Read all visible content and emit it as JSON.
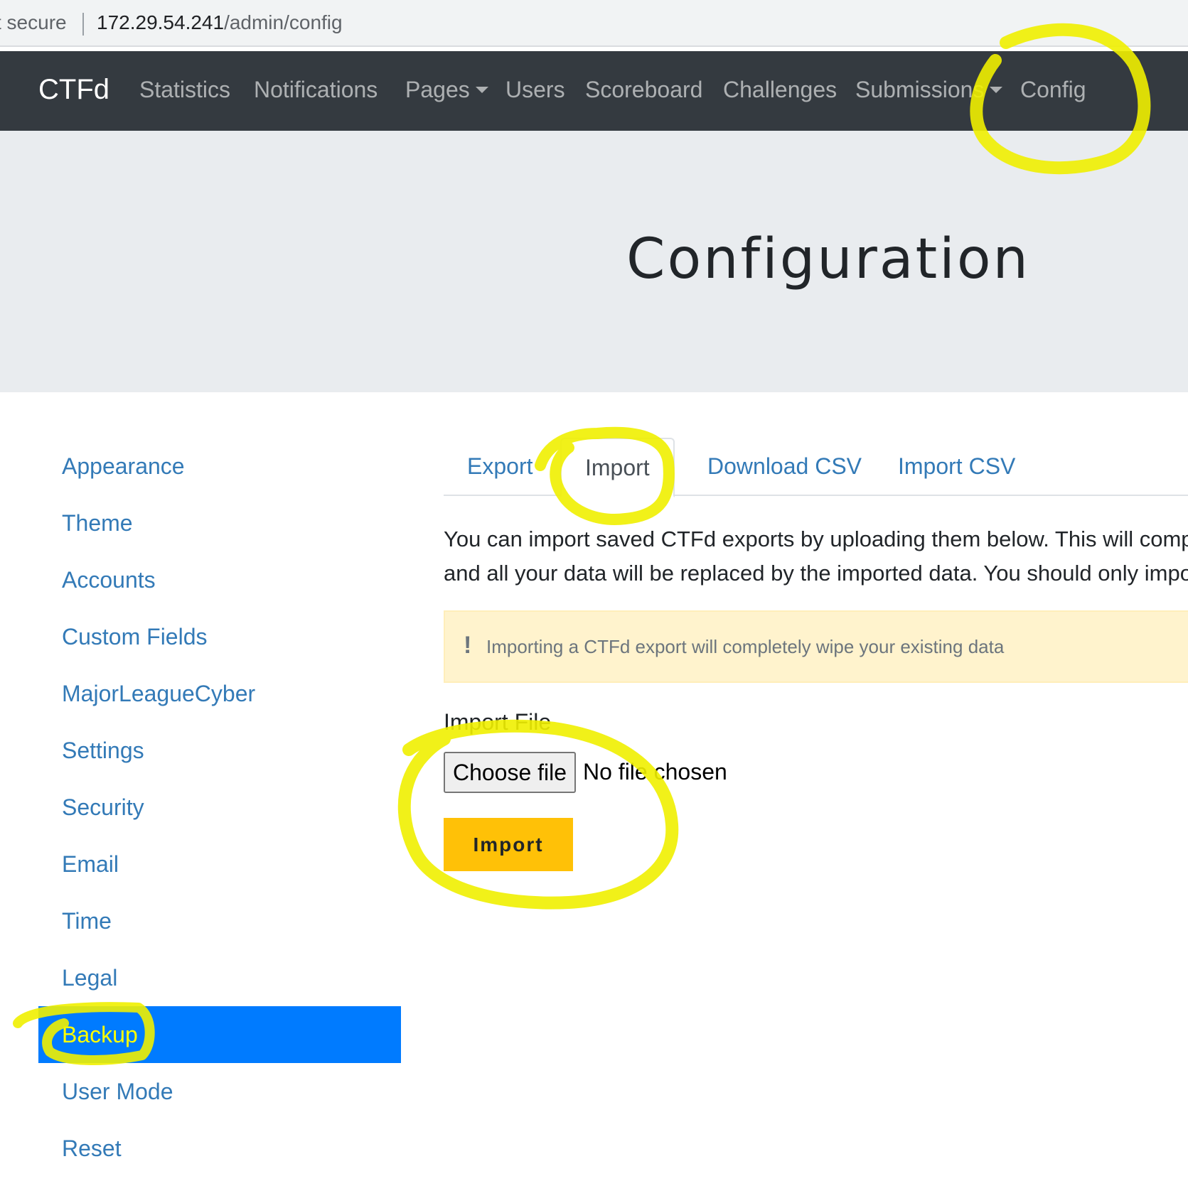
{
  "browser": {
    "security_text": "t secure",
    "url_host": "172.29.54.241",
    "url_path": "/admin/config"
  },
  "navbar": {
    "brand": "CTFd",
    "items": [
      {
        "label": "Statistics"
      },
      {
        "label": "Notifications"
      },
      {
        "label": "Pages",
        "dropdown": true
      },
      {
        "label": "Users"
      },
      {
        "label": "Scoreboard"
      },
      {
        "label": "Challenges"
      },
      {
        "label": "Submissions",
        "dropdown": true
      },
      {
        "label": "Config"
      }
    ]
  },
  "header": {
    "title": "Configuration"
  },
  "sidebar": {
    "items": [
      {
        "label": "Appearance"
      },
      {
        "label": "Theme"
      },
      {
        "label": "Accounts"
      },
      {
        "label": "Custom Fields"
      },
      {
        "label": "MajorLeagueCyber"
      },
      {
        "label": "Settings"
      },
      {
        "label": "Security"
      },
      {
        "label": "Email"
      },
      {
        "label": "Time"
      },
      {
        "label": "Legal"
      },
      {
        "label": "Backup",
        "active": true
      },
      {
        "label": "User Mode"
      },
      {
        "label": "Reset"
      }
    ]
  },
  "tabs": [
    {
      "label": "Export"
    },
    {
      "label": "Import",
      "active": true
    },
    {
      "label": "Download CSV"
    },
    {
      "label": "Import CSV"
    }
  ],
  "import_panel": {
    "description_line1": "You can import saved CTFd exports by uploading them below. This will comp",
    "description_line2": "and all your data will be replaced by the imported data. You should only impo",
    "alert_icon": "!",
    "alert_text": "Importing a CTFd export will completely wipe your existing data",
    "file_label": "Import File",
    "choose_file_label": "Choose file",
    "file_status": "No file chosen",
    "import_button": "Import"
  },
  "colors": {
    "navbar_bg": "#343a40",
    "jumbotron_bg": "#e9ecef",
    "link": "#337ab7",
    "active_sidebar": "#007bff",
    "import_button": "#ffc107",
    "alert_bg": "#fff3cd",
    "highlighter": "#f0f000"
  }
}
